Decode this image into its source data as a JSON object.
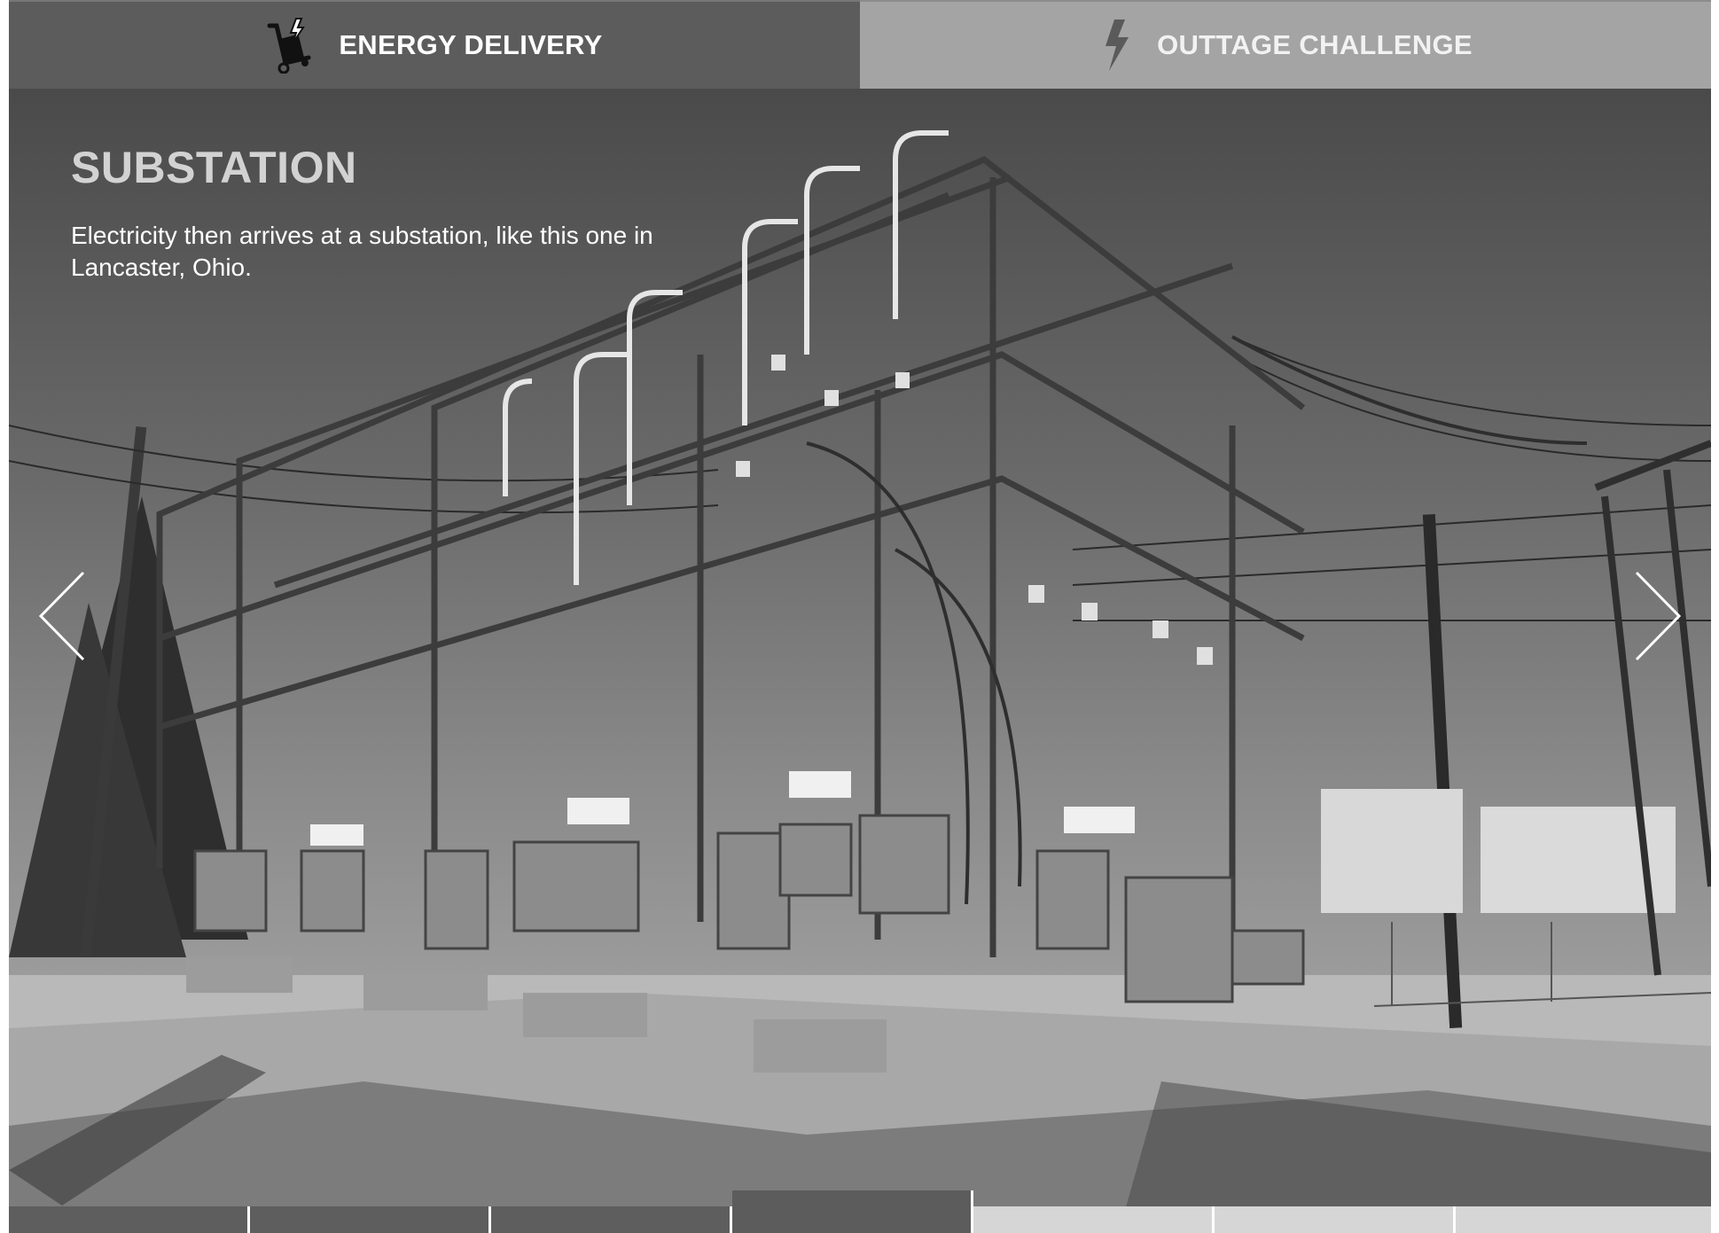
{
  "tabs": [
    {
      "label": "ENERGY DELIVERY",
      "icon": "hand-truck-bolt-icon",
      "active": true
    },
    {
      "label": "OUTTAGE CHALLENGE",
      "icon": "lightning-bolt-icon",
      "active": false
    }
  ],
  "slide": {
    "title": "SUBSTATION",
    "description": "Electricity then arrives at a substation, like this one in Lancaster, Ohio."
  },
  "navigation": {
    "prev_icon": "chevron-left-icon",
    "next_icon": "chevron-right-icon"
  },
  "progress": {
    "total_steps": 7,
    "current_step": 4
  },
  "colors": {
    "active_tab": "#5c5c5c",
    "inactive_tab": "#a4a4a4",
    "caption_title": "#d2d2d2",
    "progress_done": "#5e5e5e",
    "progress_todo": "#d6d6d6"
  }
}
